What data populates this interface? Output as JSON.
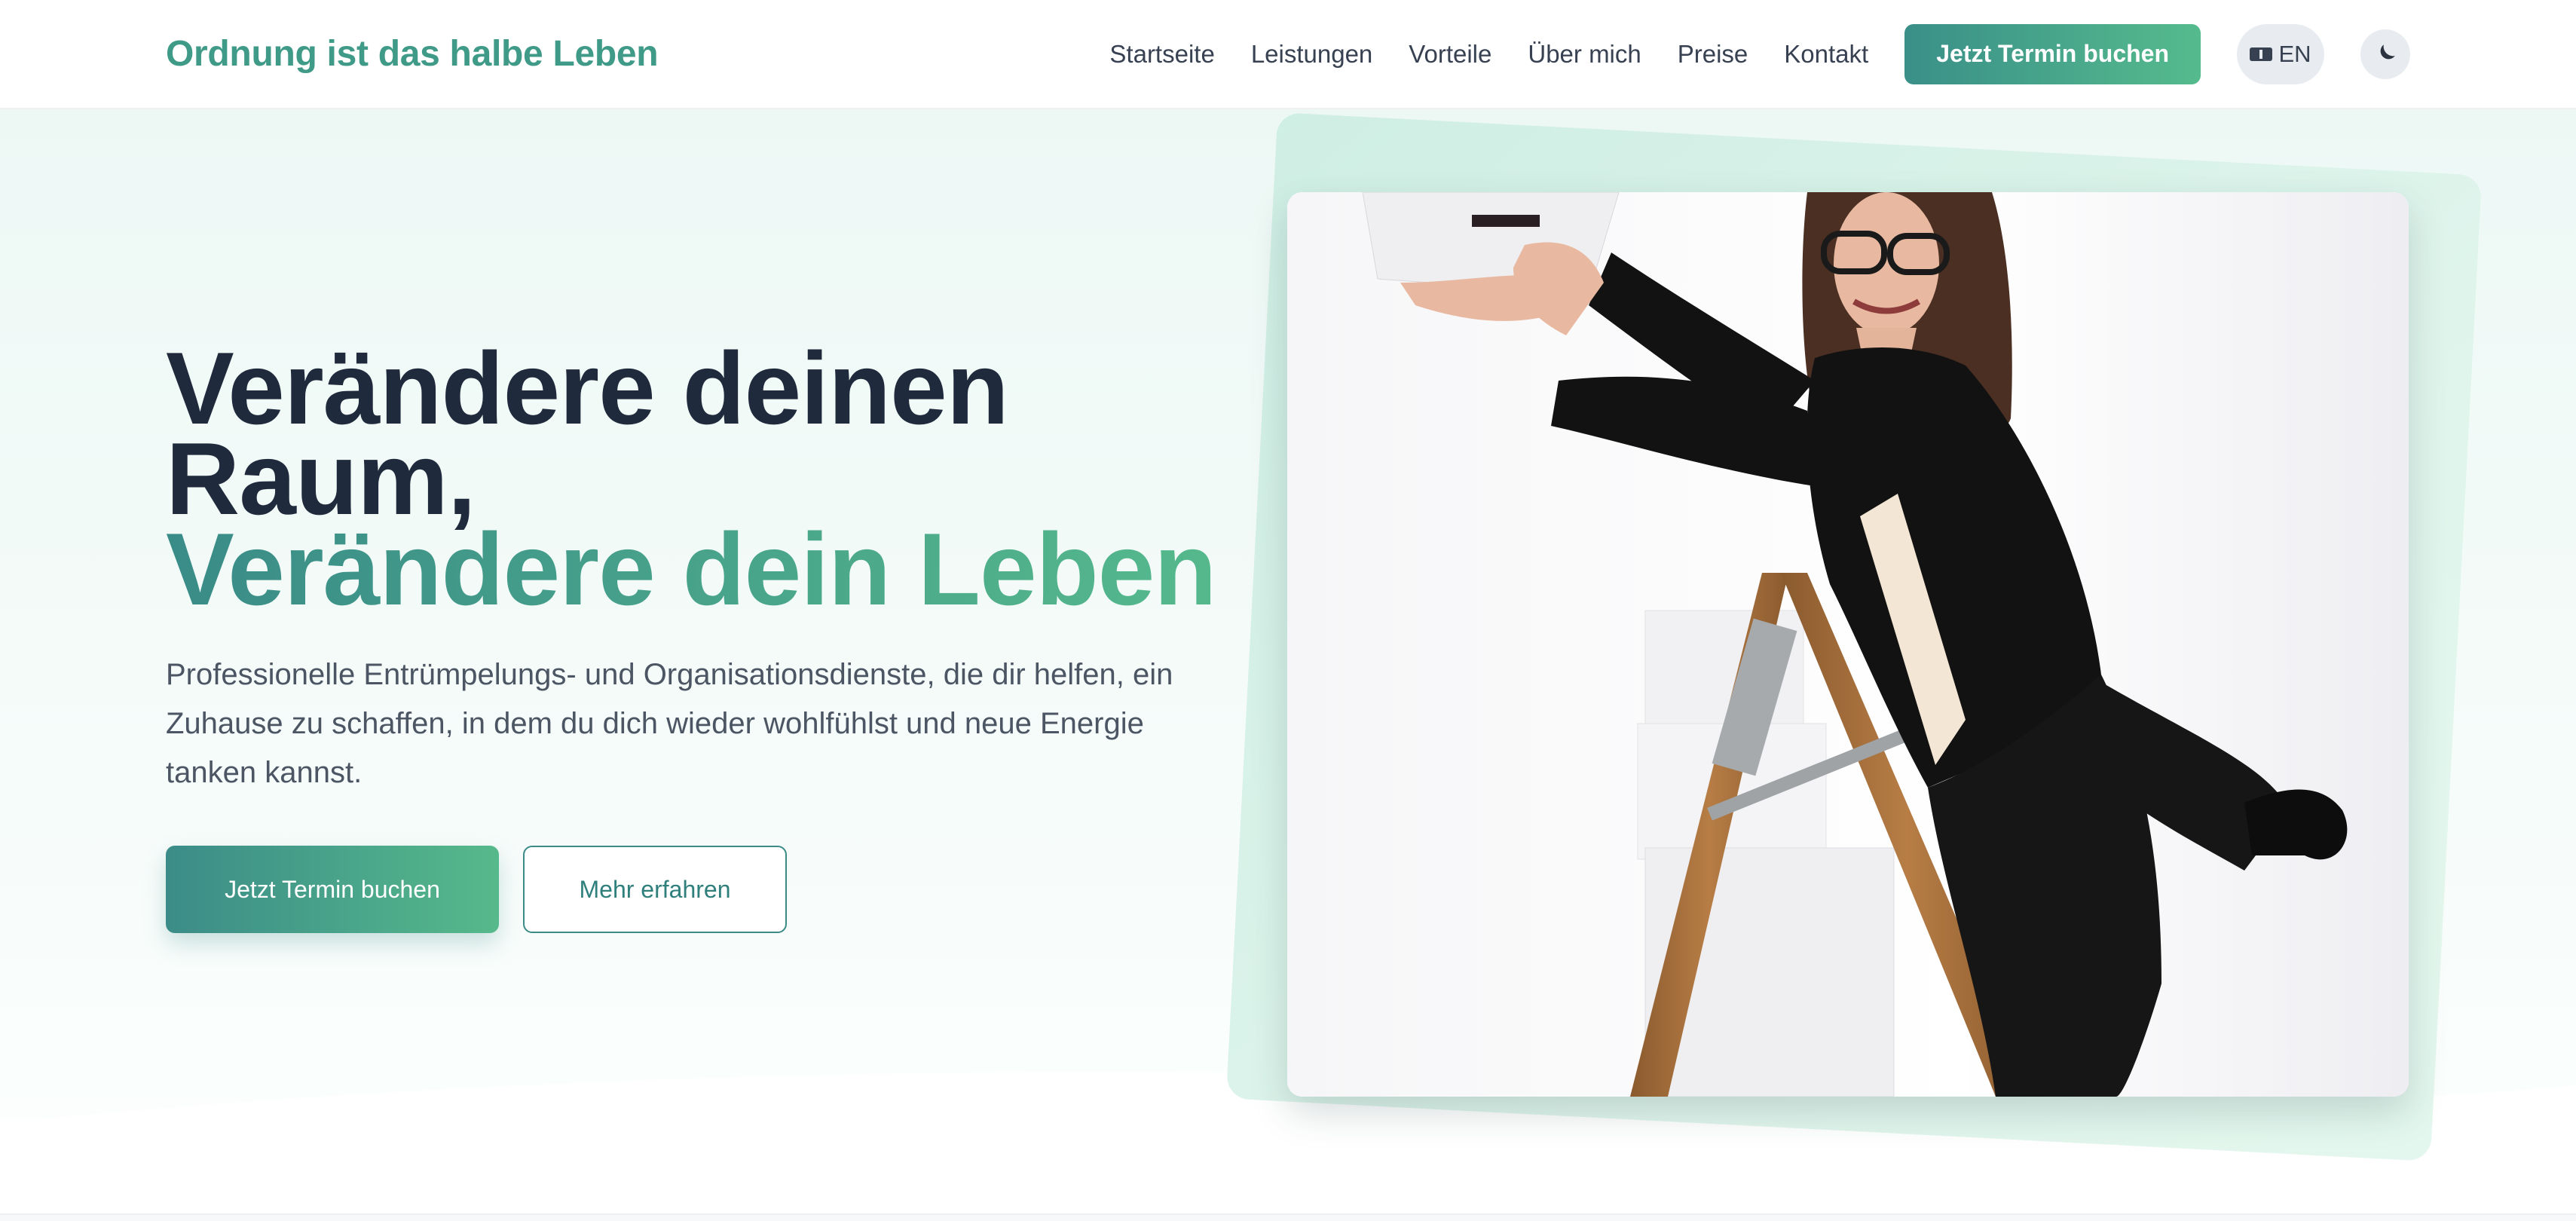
{
  "header": {
    "brand": "Ordnung ist das halbe Leben",
    "nav": [
      "Startseite",
      "Leistungen",
      "Vorteile",
      "Über mich",
      "Preise",
      "Kontakt"
    ],
    "cta_label": "Jetzt Termin buchen",
    "lang_label": "EN",
    "lang_icon": "language-icon",
    "theme_icon": "moon-icon"
  },
  "hero": {
    "title_line1": "Verändere deinen",
    "title_line2": "Raum,",
    "title_accent": "Verändere dein Leben",
    "description": "Professionelle Entrümpelungs- und Organisationsdienste, die dir helfen, ein Zuhause zu schaffen, in dem du dich wieder wohlfühlst und neue Energie tanken kannst.",
    "primary_button": "Jetzt Termin buchen",
    "secondary_button": "Mehr erfahren"
  },
  "colors": {
    "brand": "#3f9a87",
    "gradient_start": "#3a8f88",
    "gradient_end": "#55bb8d",
    "text_dark": "#1f2a3c"
  }
}
